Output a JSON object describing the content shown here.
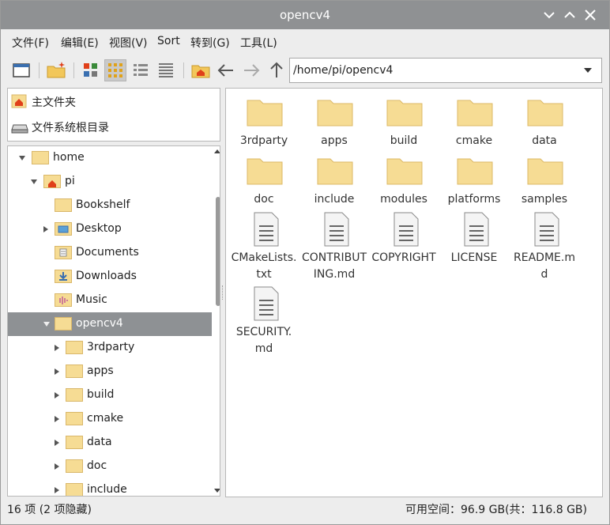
{
  "window": {
    "title": "opencv4"
  },
  "menu": [
    "文件(F)",
    "编辑(E)",
    "视图(V)",
    "Sort",
    "转到(G)",
    "工具(L)"
  ],
  "address": {
    "value": "/home/pi/opencv4"
  },
  "places": [
    {
      "label": "主文件夹",
      "icon": "home-folder-icon"
    },
    {
      "label": "文件系统根目录",
      "icon": "drive-icon"
    }
  ],
  "tree": [
    {
      "label": "home"
    },
    {
      "label": "pi"
    },
    {
      "label": "Bookshelf"
    },
    {
      "label": "Desktop"
    },
    {
      "label": "Documents"
    },
    {
      "label": "Downloads"
    },
    {
      "label": "Music"
    },
    {
      "label": "opencv4"
    },
    {
      "label": "3rdparty"
    },
    {
      "label": "apps"
    },
    {
      "label": "build"
    },
    {
      "label": "cmake"
    },
    {
      "label": "data"
    },
    {
      "label": "doc"
    },
    {
      "label": "include"
    }
  ],
  "files": [
    {
      "line1": "3rdparty",
      "line2": "",
      "kind": "folder"
    },
    {
      "line1": "apps",
      "line2": "",
      "kind": "folder"
    },
    {
      "line1": "build",
      "line2": "",
      "kind": "folder"
    },
    {
      "line1": "cmake",
      "line2": "",
      "kind": "folder"
    },
    {
      "line1": "data",
      "line2": "",
      "kind": "folder"
    },
    {
      "line1": "doc",
      "line2": "",
      "kind": "folder"
    },
    {
      "line1": "include",
      "line2": "",
      "kind": "folder"
    },
    {
      "line1": "modules",
      "line2": "",
      "kind": "folder"
    },
    {
      "line1": "platforms",
      "line2": "",
      "kind": "folder"
    },
    {
      "line1": "samples",
      "line2": "",
      "kind": "folder"
    },
    {
      "line1": "CMakeLists.",
      "line2": "txt",
      "kind": "text"
    },
    {
      "line1": "CONTRIBUT",
      "line2": "ING.md",
      "kind": "text"
    },
    {
      "line1": "COPYRIGHT",
      "line2": "",
      "kind": "text"
    },
    {
      "line1": "LICENSE",
      "line2": "",
      "kind": "text"
    },
    {
      "line1": "README.m",
      "line2": "d",
      "kind": "text"
    },
    {
      "line1": "SECURITY.",
      "line2": "md",
      "kind": "text"
    }
  ],
  "status": {
    "left": "16 项 (2 项隐藏)",
    "right": "可用空间：96.9 GB(共：116.8 GB)"
  },
  "colors": {
    "titlebar": "#8f9193",
    "selection": "#8e9194",
    "folder": "#f6dc94",
    "home_badge": "#e0401a"
  }
}
